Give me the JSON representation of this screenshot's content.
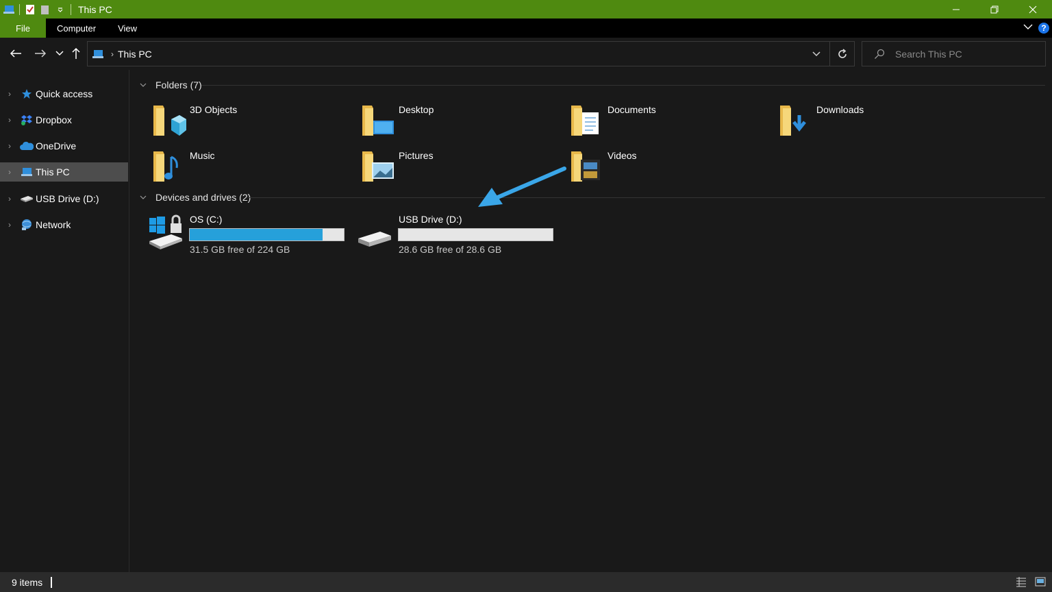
{
  "window": {
    "title": "This PC",
    "accent_color": "#4f8a10",
    "minimize_icon": "minimize-icon",
    "restore_icon": "restore-icon",
    "close_icon": "close-icon"
  },
  "ribbon": {
    "tabs": [
      {
        "label": "File",
        "active": true
      },
      {
        "label": "Computer"
      },
      {
        "label": "View"
      }
    ],
    "help_label": "?"
  },
  "navigation": {
    "address_crumb": "This PC",
    "search_placeholder": "Search This PC"
  },
  "sidebar": {
    "items": [
      {
        "label": "Quick access",
        "icon": "star-icon"
      },
      {
        "label": "Dropbox",
        "icon": "dropbox-icon"
      },
      {
        "label": "OneDrive",
        "icon": "cloud-icon"
      },
      {
        "label": "This PC",
        "icon": "computer-icon",
        "selected": true
      },
      {
        "label": "USB Drive (D:)",
        "icon": "usb-drive-icon"
      },
      {
        "label": "Network",
        "icon": "network-icon"
      }
    ]
  },
  "content": {
    "folders_header": "Folders (7)",
    "folders": [
      {
        "label": "3D Objects",
        "icon": "3d-objects-folder-icon"
      },
      {
        "label": "Desktop",
        "icon": "desktop-folder-icon"
      },
      {
        "label": "Documents",
        "icon": "documents-folder-icon"
      },
      {
        "label": "Downloads",
        "icon": "downloads-folder-icon"
      },
      {
        "label": "Music",
        "icon": "music-folder-icon"
      },
      {
        "label": "Pictures",
        "icon": "pictures-folder-icon"
      },
      {
        "label": "Videos",
        "icon": "videos-folder-icon"
      }
    ],
    "drives_header": "Devices and drives (2)",
    "drives": [
      {
        "name": "OS (C:)",
        "free_text": "31.5 GB free of 224 GB",
        "used_fraction": 0.86,
        "icon": "windows-drive-icon"
      },
      {
        "name": "USB Drive (D:)",
        "free_text": "28.6 GB free of 28.6 GB",
        "used_fraction": 0.0,
        "icon": "usb-drive-icon"
      }
    ],
    "annotation_arrow_color": "#3aa6e8"
  },
  "status": {
    "item_count": "9 items"
  }
}
